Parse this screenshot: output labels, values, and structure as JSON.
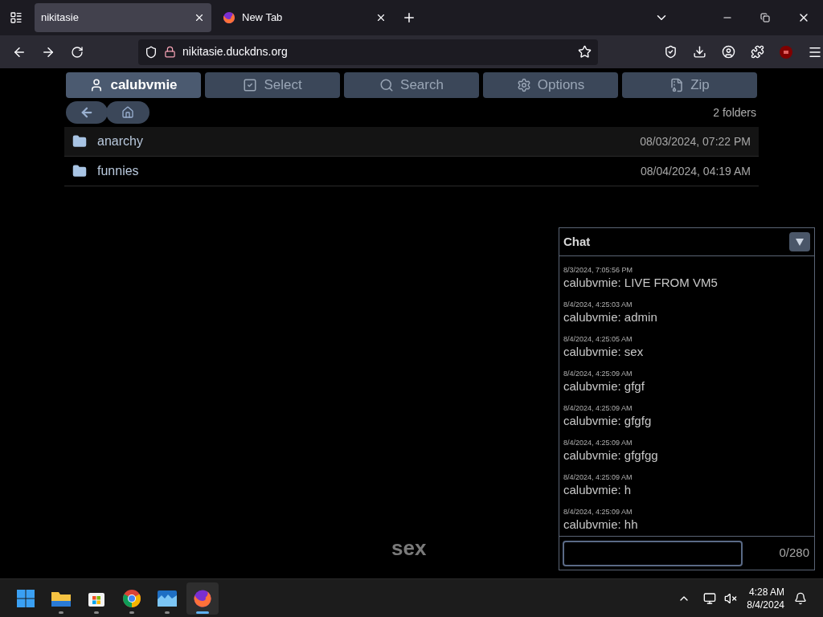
{
  "browser": {
    "tabs": [
      {
        "title": "nikitasie",
        "selected": true,
        "kind": "plain"
      },
      {
        "title": "New Tab",
        "selected": false,
        "kind": "firefox"
      }
    ],
    "url": "nikitasie.duckdns.org"
  },
  "toolbar": [
    {
      "label": "calubvmie",
      "selected": true,
      "kind": "user"
    },
    {
      "label": "Select",
      "selected": false,
      "kind": "select"
    },
    {
      "label": "Search",
      "selected": false,
      "kind": "search"
    },
    {
      "label": "Options",
      "selected": false,
      "kind": "options"
    },
    {
      "label": "Zip",
      "selected": false,
      "kind": "zip"
    }
  ],
  "folder_count": "2 folders",
  "folders": [
    {
      "name": "anarchy",
      "date": "08/03/2024, 07:22 PM",
      "highlighted": true
    },
    {
      "name": "funnies",
      "date": "08/04/2024, 04:19 AM",
      "highlighted": false
    }
  ],
  "footer_text": "sex",
  "chat": {
    "title": "Chat",
    "messages": [
      {
        "time": "8/3/2024, 7:05:56 PM",
        "text": "calubvmie: LIVE FROM VM5"
      },
      {
        "time": "8/4/2024, 4:25:03 AM",
        "text": "calubvmie: admin"
      },
      {
        "time": "8/4/2024, 4:25:05 AM",
        "text": "calubvmie: sex"
      },
      {
        "time": "8/4/2024, 4:25:09 AM",
        "text": "calubvmie: gfgf"
      },
      {
        "time": "8/4/2024, 4:25:09 AM",
        "text": "calubvmie: gfgfg"
      },
      {
        "time": "8/4/2024, 4:25:09 AM",
        "text": "calubvmie: gfgfgg"
      },
      {
        "time": "8/4/2024, 4:25:09 AM",
        "text": "calubvmie: h"
      },
      {
        "time": "8/4/2024, 4:25:09 AM",
        "text": "calubvmie: hh"
      }
    ],
    "counter": "0/280"
  },
  "taskbar": {
    "apps": [
      {
        "kind": "start",
        "active": false
      },
      {
        "kind": "files",
        "active": false
      },
      {
        "kind": "store",
        "active": false
      },
      {
        "kind": "chrome",
        "active": false
      },
      {
        "kind": "photos",
        "active": false
      },
      {
        "kind": "firefox",
        "active": true
      }
    ],
    "time": "4:28 AM",
    "date": "8/4/2024"
  }
}
